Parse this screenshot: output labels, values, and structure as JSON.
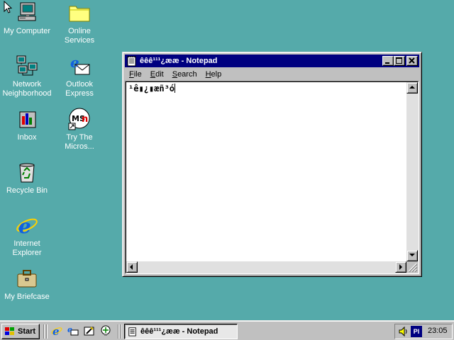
{
  "desktop": {
    "icons": [
      {
        "label": "My Computer",
        "icon": "my-computer-icon"
      },
      {
        "label": "Online Services",
        "icon": "folder-icon"
      },
      {
        "label": "Network Neighborhood",
        "icon": "network-icon"
      },
      {
        "label": "Outlook Express",
        "icon": "outlook-express-icon"
      },
      {
        "label": "Inbox",
        "icon": "inbox-icon"
      },
      {
        "label": "Try The Micros...",
        "icon": "msn-icon"
      },
      {
        "label": "Recycle Bin",
        "icon": "recycle-bin-icon"
      },
      {
        "label": "Internet Explorer",
        "icon": "internet-explorer-icon"
      },
      {
        "label": "My Briefcase",
        "icon": "briefcase-icon"
      }
    ],
    "background_color": "#55aaaa"
  },
  "notepad": {
    "title": "êêê¹¹¹¿ææ - Notepad",
    "menu": [
      "File",
      "Edit",
      "Search",
      "Help"
    ],
    "menu_underline": [
      "F",
      "E",
      "S",
      "H"
    ],
    "content": "¹ê▮¿▮æñ³ó",
    "title_bar_color": "#000080"
  },
  "taskbar": {
    "start_label": "Start",
    "task_label": "êêê¹¹¹¿ææ - Notepad",
    "lang_indicator": "Pl",
    "clock": "23:05"
  }
}
